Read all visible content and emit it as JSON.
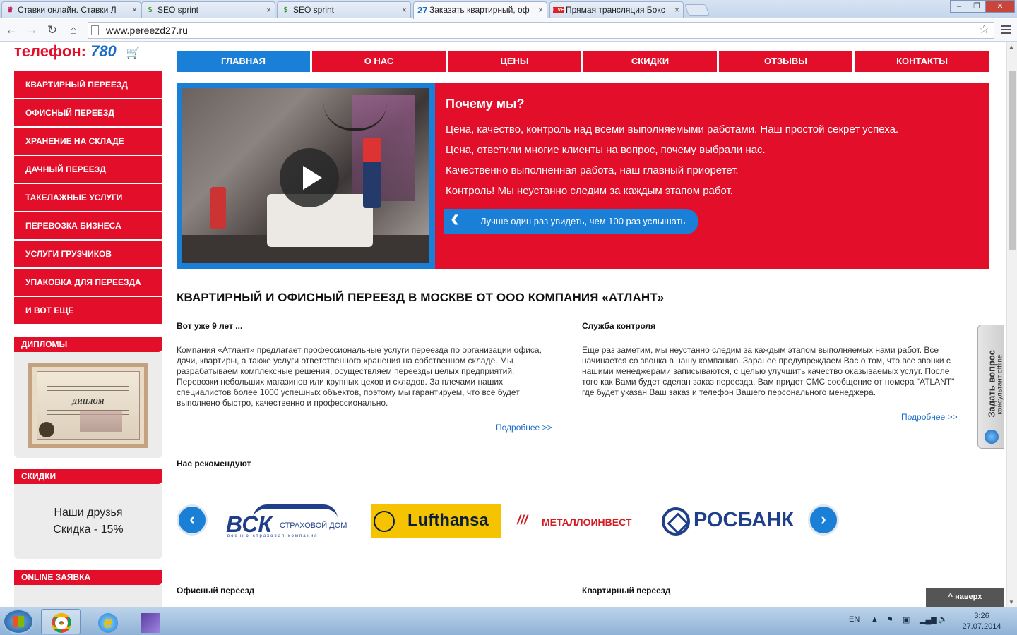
{
  "browser": {
    "tabs": [
      {
        "label": "Ставки онлайн. Ставки Л",
        "favicon": "stavki-favicon"
      },
      {
        "label": "SEO sprint",
        "favicon": "seosprint-favicon"
      },
      {
        "label": "SEO sprint",
        "favicon": "seosprint-favicon"
      },
      {
        "label": "Заказать квартирный, оф",
        "favicon": "27"
      },
      {
        "label": "Прямая трансляция Бокс",
        "favicon": "LIVE"
      }
    ],
    "active_tab": 3,
    "url": "www.pereezd27.ru"
  },
  "site": {
    "logo_text": "телефон:",
    "logo_number": "780",
    "top_nav": [
      "ГЛАВНАЯ",
      "О НАС",
      "ЦЕНЫ",
      "СКИДКИ",
      "ОТЗЫВЫ",
      "КОНТАКТЫ"
    ],
    "top_nav_active": 0,
    "left_menu": [
      "КВАРТИРНЫЙ ПЕРЕЕЗД",
      "ОФИСНЫЙ ПЕРЕЕЗД",
      "ХРАНЕНИЕ НА СКЛАДЕ",
      "ДАЧНЫЙ ПЕРЕЕЗД",
      "ТАКЕЛАЖНЫЕ УСЛУГИ",
      "ПЕРЕВОЗКА БИЗНЕСА",
      "УСЛУГИ ГРУЗЧИКОВ",
      "УПАКОВКА ДЛЯ ПЕРЕЕЗДА",
      "И ВОТ ЕЩЕ"
    ],
    "diplomas_title": "ДИПЛОМЫ",
    "diploma_text": "ДИПЛОМ",
    "discounts_title": "СКИДКИ",
    "discount_line1": "Наши друзья",
    "discount_line2": "Скидка - 15%",
    "online_title": "ONLINE ЗАЯВКА",
    "hero": {
      "title": "Почему мы?",
      "lines": [
        "Цена, качество, контроль над всеми выполняемыми работами. Наш простой секрет успеха.",
        "Цена, ответили многие клиенты на вопрос, почему выбрали нас.",
        "Качественно выполненная работа, наш главный приоретет.",
        "Контроль! Мы неустанно следим за каждым этапом работ."
      ],
      "watch_button": "Лучше один раз увидеть, чем 100 раз услышать"
    },
    "main_heading": "КВАРТИРНЫЙ И ОФИСНЫЙ ПЕРЕЕЗД В МОСКВЕ ОТ ООО КОМПАНИЯ «АТЛАНТ»",
    "col1": {
      "title": "Вот уже 9 лет ...",
      "text": "Компания «Атлант» предлагает профессиональные услуги переезда по организации офиса, дачи, квартиры, а также услуги ответственного хранения на собственном складе. Мы разрабатываем комплексные решения, осуществляем переезды целых предприятий. Перевозки небольших магазинов или крупных цехов и складов. За плечами наших специалистов более 1000 успешных объектов, поэтому мы гарантируем, что все будет выполнено быстро, качественно и профессионально.",
      "more": "Подробнее >>"
    },
    "col2": {
      "title": "Служба контроля",
      "text": "Еще раз заметим, мы неустанно следим за каждым этапом выполняемых нами работ. Все начинается со звонка в нашу компанию. Заранее предупреждаем Вас о том, что все звонки с нашими менеджерами записываются, с целью улучшить качество оказываемых услуг. После того как Вами будет сделан заказ переезда, Вам придет СМС сообщение от номера \"ATLANT\" где будет указан Ваш заказ и телефон Вашего персонального менеджера.",
      "more": "Подробнее >>"
    },
    "recommend_title": "Нас рекомендуют",
    "partners": {
      "vsk_big": "ВСК",
      "vsk_small": "СТРАХОВОЙ ДОМ",
      "vsk_tiny": "военно-страховая компания",
      "lufthansa": "Lufthansa",
      "metall": "МЕТАЛЛОИНВЕСТ",
      "rosbank": "РОСБАНК"
    },
    "bottom_left": "Офисный переезд",
    "bottom_right": "Квартирный переезд",
    "ask_title": "Задать вопрос",
    "ask_sub": "консультант offline",
    "to_top": "^ наверх"
  },
  "taskbar": {
    "lang": "EN",
    "time": "3:26",
    "date": "27.07.2014"
  },
  "colors": {
    "brand_red": "#e30e2a",
    "brand_blue": "#1a7fd6"
  }
}
